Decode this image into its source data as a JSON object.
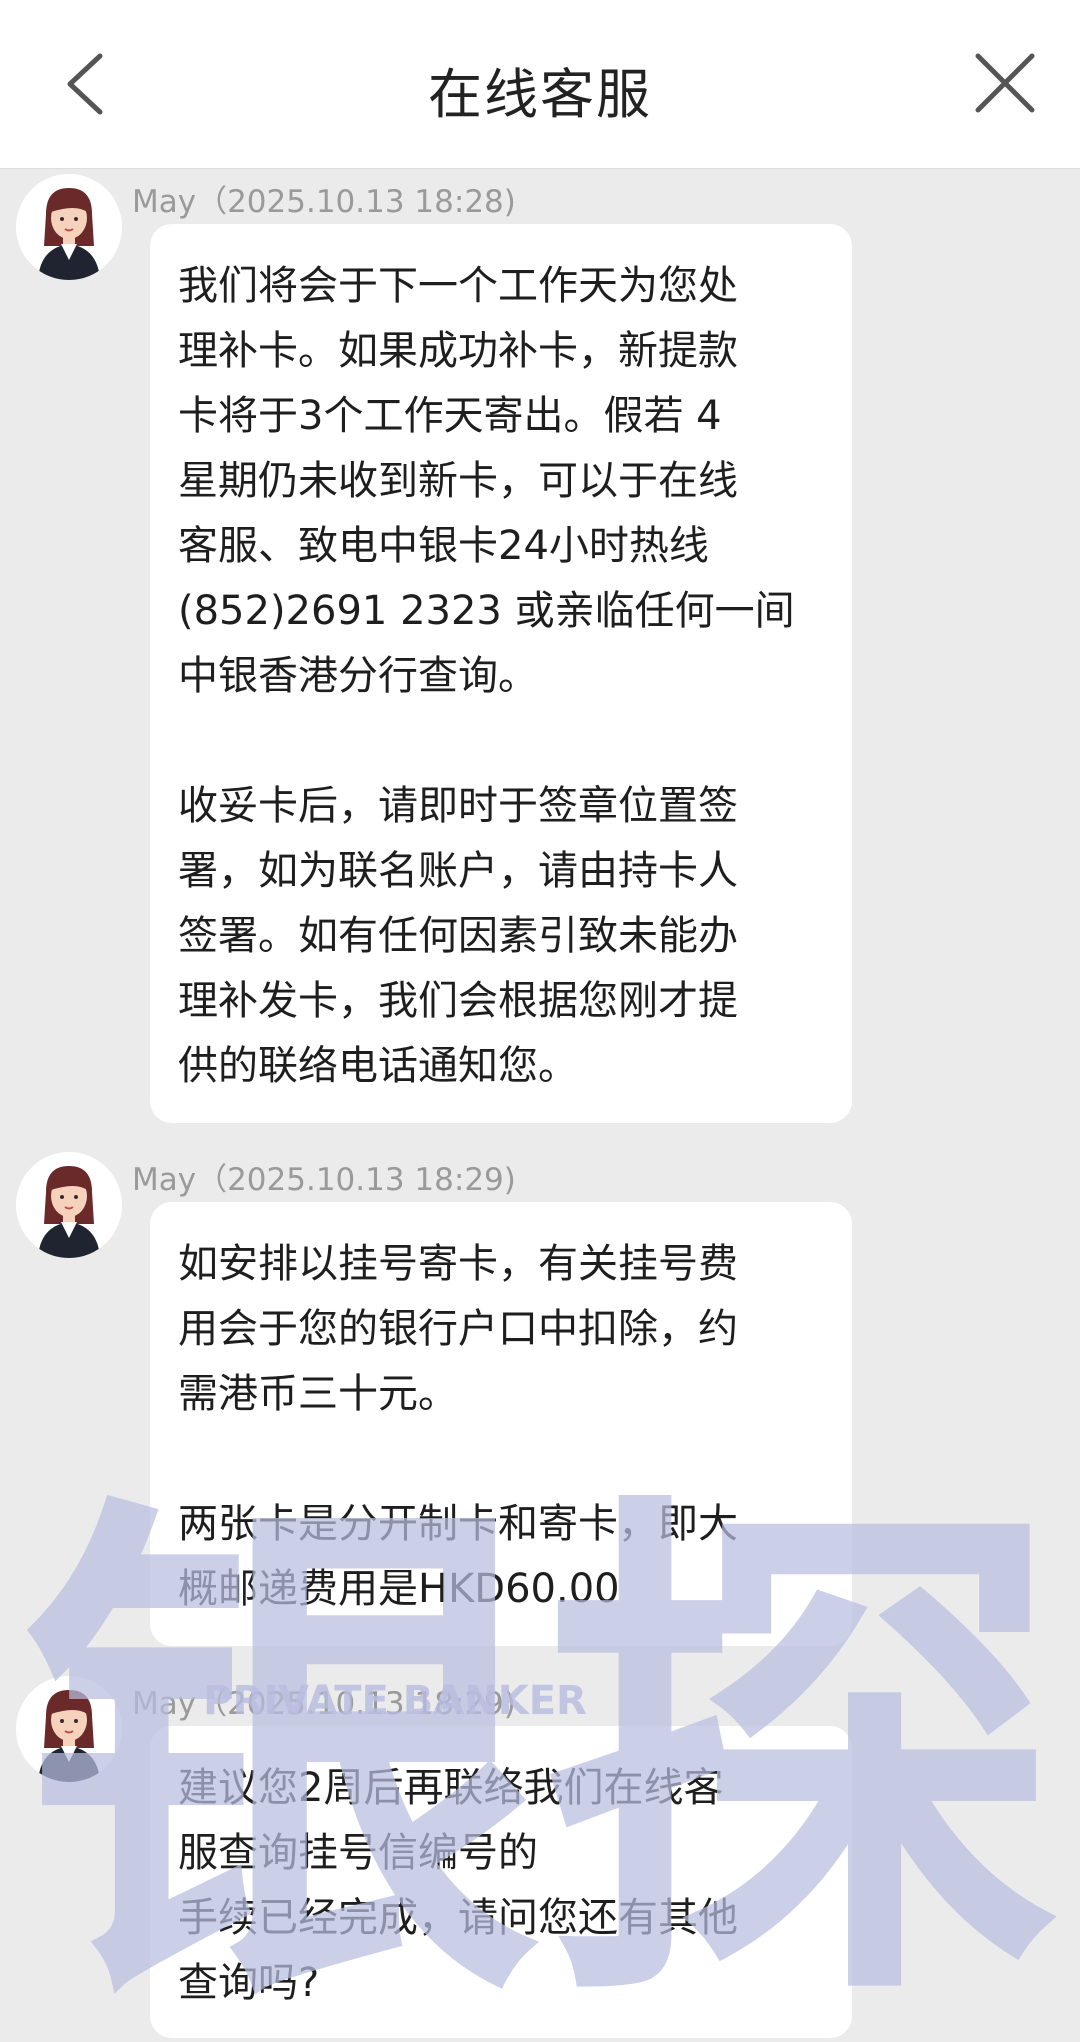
{
  "header": {
    "title": "在线客服"
  },
  "messages": [
    {
      "sender": "May",
      "meta": "May（2025.10.13 18:28)",
      "paragraphs": [
        "我们将会于下一个工作天为您处\n理补卡。如果成功补卡，新提款\n卡将于3个工作天寄出。假若 4\n星期仍未收到新卡，可以于在线\n客服、致电中银卡24小时热线\n(852)2691 2323 或亲临任何一间\n中银香港分行查询。",
        "收妥卡后，请即时于签章位置签\n署，如为联名账户，请由持卡人\n签署。如有任何因素引致未能办\n理补发卡，我们会根据您刚才提\n供的联络电话通知您。"
      ]
    },
    {
      "sender": "May",
      "meta": "May（2025.10.13 18:29)",
      "paragraphs": [
        "如安排以挂号寄卡，有关挂号费\n用会于您的银行户口中扣除，约\n需港币三十元。",
        "两张卡是分开制卡和寄卡，即大\n概邮递费用是HKD60.00"
      ]
    },
    {
      "sender": "May",
      "meta": "May（2025.10.13 18:29)",
      "paragraphs": [
        "建议您2周后再联络我们在线客\n服查询挂号信编号的\n手续已经完成，请问您还有其他\n查询吗?"
      ]
    }
  ],
  "watermark": {
    "big_text": "银探",
    "sub_text": "PRIVATE BANKER",
    "color": "#b8bcdf"
  },
  "icons": {
    "back": "chevron-left-icon",
    "close": "close-icon",
    "avatar": "female-agent-avatar-icon"
  }
}
